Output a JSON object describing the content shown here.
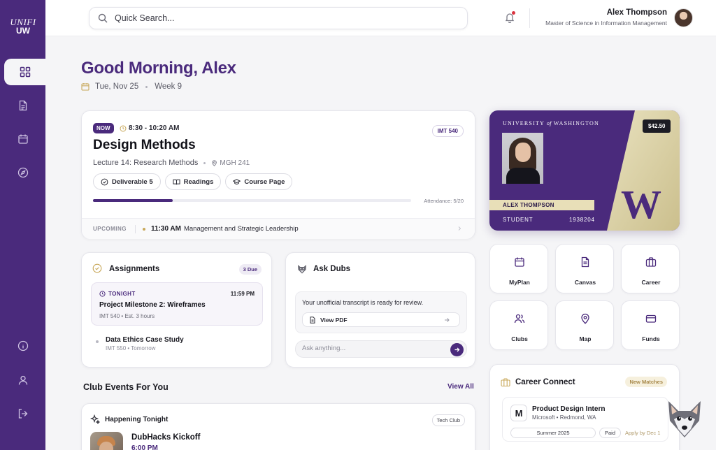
{
  "brand": {
    "logo_line1": "UNIFI",
    "logo_line2": "UW"
  },
  "sidebar": {
    "items": [
      {
        "name": "dashboard",
        "icon": "grid-icon",
        "active": true
      },
      {
        "name": "documents",
        "icon": "document-icon"
      },
      {
        "name": "calendar",
        "icon": "calendar-icon"
      },
      {
        "name": "explore",
        "icon": "compass-icon"
      },
      {
        "name": "info",
        "icon": "info-icon"
      },
      {
        "name": "profile",
        "icon": "user-icon"
      },
      {
        "name": "logout",
        "icon": "logout-icon"
      }
    ]
  },
  "search": {
    "placeholder": "Quick Search..."
  },
  "user": {
    "name": "Alex Thompson",
    "program": "Master of Science in Information Management"
  },
  "greeting": {
    "title": "Good Morning, Alex",
    "date": "Tue, Nov 25",
    "week": "Week 9"
  },
  "current_class": {
    "badge": "NOW",
    "time": "8:30 - 10:20 AM",
    "code": "IMT 540",
    "title": "Design Methods",
    "lecture": "Lecture 14: Research Methods",
    "location": "MGH 241",
    "buttons": {
      "deliverable": "Deliverable 5",
      "readings": "Readings",
      "course_page": "Course Page"
    },
    "progress": 0.25,
    "attendance": "Attendance: 5/20",
    "upcoming_label": "UPCOMING",
    "upcoming_time": "11:30 AM",
    "upcoming_text": "Management and Strategic Leadership"
  },
  "id_card": {
    "university": "UNIVERSITY",
    "of": "of",
    "washington": "WASHINGTON",
    "balance": "$42.50",
    "name": "ALEX THOMPSON",
    "role": "STUDENT",
    "number": "1938204",
    "mark": "W",
    "colors": {
      "purple": "#4a2a7c",
      "gold": "#d9cfa3"
    }
  },
  "quick_links": [
    {
      "label": "MyPlan",
      "icon": "calendar-icon"
    },
    {
      "label": "Canvas",
      "icon": "document-icon"
    },
    {
      "label": "Career",
      "icon": "briefcase-icon"
    },
    {
      "label": "Clubs",
      "icon": "users-icon"
    },
    {
      "label": "Map",
      "icon": "map-pin-icon"
    },
    {
      "label": "Funds",
      "icon": "credit-card-icon"
    }
  ],
  "assignments": {
    "title": "Assignments",
    "badge": "3 Due",
    "featured": {
      "tag": "TONIGHT",
      "due": "11:59 PM",
      "title": "Project Milestone 2: Wireframes",
      "meta": "IMT 540 • Est. 3 hours"
    },
    "next": {
      "title": "Data Ethics Case Study",
      "meta": "IMT 550 • Tomorrow"
    }
  },
  "ask_dubs": {
    "title": "Ask Dubs",
    "message": "Your unofficial transcript is ready for review.",
    "action": "View PDF",
    "placeholder": "Ask anything..."
  },
  "club_events": {
    "heading": "Club Events For You",
    "view_all": "View All",
    "section": "Happening Tonight",
    "tag": "Tech Club",
    "event_title": "DubHacks Kickoff",
    "event_time": "6:00 PM"
  },
  "career_connect": {
    "title": "Career Connect",
    "badge": "New Matches",
    "job": {
      "logo": "M",
      "title": "Product Design Intern",
      "company": "Microsoft • Redmond, WA",
      "season": "Summer 2025",
      "paid": "Paid",
      "apply": "Apply by Dec 1"
    }
  }
}
